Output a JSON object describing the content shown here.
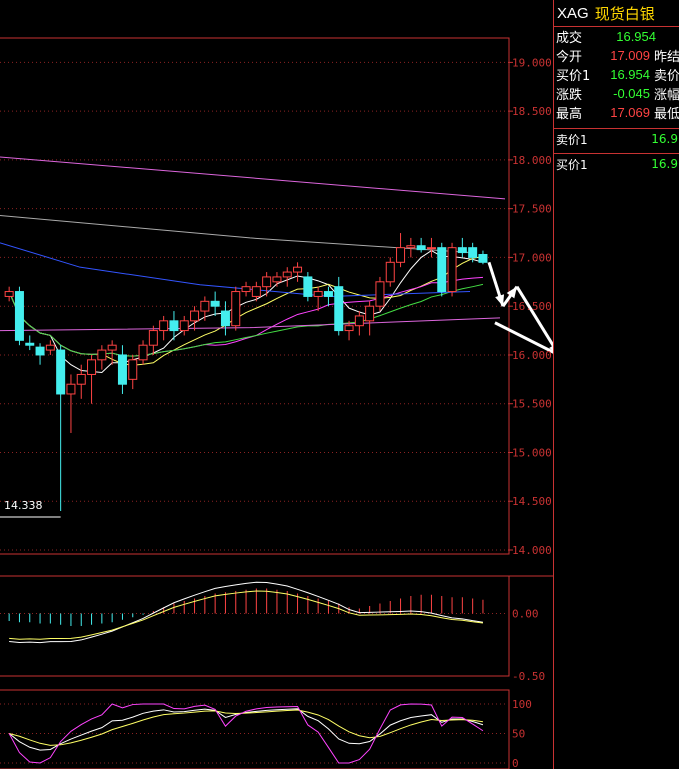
{
  "panel": {
    "symbol": "XAG",
    "name": "现货白银",
    "rows": [
      {
        "label": "成交",
        "value": "16.954",
        "color": "#33ff33",
        "label2": ""
      },
      {
        "label": "今开",
        "value": "17.009",
        "color": "#ff4444",
        "label2": "昨结"
      },
      {
        "label": "买价1",
        "value": "16.954",
        "color": "#33ff33",
        "label2": "卖价"
      },
      {
        "label": "涨跌",
        "value": "-0.045",
        "color": "#33ff33",
        "label2": "涨幅"
      },
      {
        "label": "最高",
        "value": "17.069",
        "color": "#ff4444",
        "label2": "最低"
      }
    ],
    "quotes": [
      {
        "label": "卖价1",
        "value": "16.9"
      },
      {
        "label": "买价1",
        "value": "16.9"
      }
    ]
  },
  "colors": {
    "up": "#ff4444",
    "down": "#44eeee",
    "grid": "#c83232",
    "ma_white": "#ffffff",
    "ma_yellow": "#ffff66",
    "ma_magenta": "#ff44ff",
    "ma_green": "#44dd44",
    "ma_blue": "#3355ff",
    "ma_gray": "#aaaaaa",
    "ma_pink": "#dd66dd"
  },
  "chart_data": [
    {
      "type": "candlestick",
      "ylim": [
        14.0,
        19.25
      ],
      "yticks": [
        "19.000",
        "18.500",
        "18.000",
        "17.500",
        "17.000",
        "16.500",
        "16.000",
        "15.500",
        "15.000",
        "14.500",
        "14.000"
      ],
      "annotations": [
        {
          "text": "14.338",
          "value": 14.338
        }
      ],
      "candles": [
        [
          16.6,
          16.7,
          16.55,
          16.65
        ],
        [
          16.65,
          16.7,
          16.1,
          16.15
        ],
        [
          16.12,
          16.2,
          16.05,
          16.1
        ],
        [
          16.08,
          16.12,
          15.9,
          16.0
        ],
        [
          16.05,
          16.15,
          16.0,
          16.1
        ],
        [
          16.05,
          16.1,
          14.4,
          15.6
        ],
        [
          15.6,
          15.8,
          15.2,
          15.7
        ],
        [
          15.7,
          15.9,
          15.55,
          15.8
        ],
        [
          15.8,
          16.0,
          15.5,
          15.95
        ],
        [
          15.95,
          16.1,
          15.85,
          16.05
        ],
        [
          16.05,
          16.15,
          15.9,
          16.1
        ],
        [
          16.0,
          16.1,
          15.6,
          15.7
        ],
        [
          15.75,
          16.0,
          15.65,
          15.95
        ],
        [
          15.95,
          16.15,
          15.9,
          16.1
        ],
        [
          16.1,
          16.3,
          16.0,
          16.25
        ],
        [
          16.25,
          16.4,
          16.15,
          16.35
        ],
        [
          16.35,
          16.45,
          16.15,
          16.25
        ],
        [
          16.25,
          16.4,
          16.2,
          16.35
        ],
        [
          16.35,
          16.5,
          16.25,
          16.45
        ],
        [
          16.45,
          16.6,
          16.35,
          16.55
        ],
        [
          16.55,
          16.65,
          16.4,
          16.5
        ],
        [
          16.45,
          16.55,
          16.2,
          16.3
        ],
        [
          16.3,
          16.7,
          16.25,
          16.65
        ],
        [
          16.65,
          16.75,
          16.6,
          16.7
        ],
        [
          16.6,
          16.75,
          16.55,
          16.7
        ],
        [
          16.7,
          16.85,
          16.6,
          16.8
        ],
        [
          16.75,
          16.85,
          16.7,
          16.8
        ],
        [
          16.8,
          16.9,
          16.7,
          16.85
        ],
        [
          16.85,
          16.95,
          16.75,
          16.9
        ],
        [
          16.8,
          16.85,
          16.55,
          16.6
        ],
        [
          16.6,
          16.7,
          16.45,
          16.65
        ],
        [
          16.65,
          16.7,
          16.5,
          16.6
        ],
        [
          16.7,
          16.8,
          16.2,
          16.25
        ],
        [
          16.25,
          16.35,
          16.15,
          16.3
        ],
        [
          16.3,
          16.45,
          16.2,
          16.4
        ],
        [
          16.35,
          16.55,
          16.2,
          16.5
        ],
        [
          16.5,
          16.8,
          16.45,
          16.75
        ],
        [
          16.75,
          17.0,
          16.7,
          16.95
        ],
        [
          16.95,
          17.25,
          16.9,
          17.1
        ],
        [
          17.1,
          17.2,
          17.0,
          17.12
        ],
        [
          17.12,
          17.2,
          17.05,
          17.08
        ],
        [
          17.1,
          17.2,
          17.0,
          17.1
        ],
        [
          17.1,
          17.15,
          16.6,
          16.65
        ],
        [
          16.65,
          17.15,
          16.6,
          17.1
        ],
        [
          17.1,
          17.2,
          17.0,
          17.05
        ],
        [
          17.1,
          17.15,
          16.95,
          17.0
        ],
        [
          17.03,
          17.07,
          16.93,
          16.95
        ]
      ],
      "projection": [
        {
          "dx": 0,
          "value": 16.95
        },
        {
          "dx": 14,
          "value": 16.5
        },
        {
          "dx": 28,
          "value": 16.7
        },
        {
          "dx": 70,
          "value": 16.0
        },
        {
          "dx": 112,
          "value": 15.45
        },
        {
          "dx": 190,
          "value": 16.85
        }
      ]
    },
    {
      "type": "bar",
      "ylim": [
        -0.5,
        0.3
      ],
      "yticks": [
        "0.00",
        "-0.50"
      ],
      "macd_hist": [
        -0.06,
        -0.07,
        -0.07,
        -0.08,
        -0.08,
        -0.09,
        -0.1,
        -0.1,
        -0.09,
        -0.08,
        -0.07,
        -0.05,
        -0.03,
        -0.01,
        0.02,
        0.05,
        0.08,
        0.1,
        0.12,
        0.14,
        0.16,
        0.17,
        0.18,
        0.19,
        0.2,
        0.2,
        0.19,
        0.18,
        0.16,
        0.14,
        0.12,
        0.1,
        0.08,
        0.05,
        0.04,
        0.06,
        0.08,
        0.1,
        0.12,
        0.14,
        0.15,
        0.15,
        0.14,
        0.13,
        0.13,
        0.12,
        0.11
      ]
    },
    {
      "type": "line",
      "ylim": [
        0,
        100
      ],
      "yticks": [
        "100",
        "50",
        "0"
      ]
    }
  ]
}
